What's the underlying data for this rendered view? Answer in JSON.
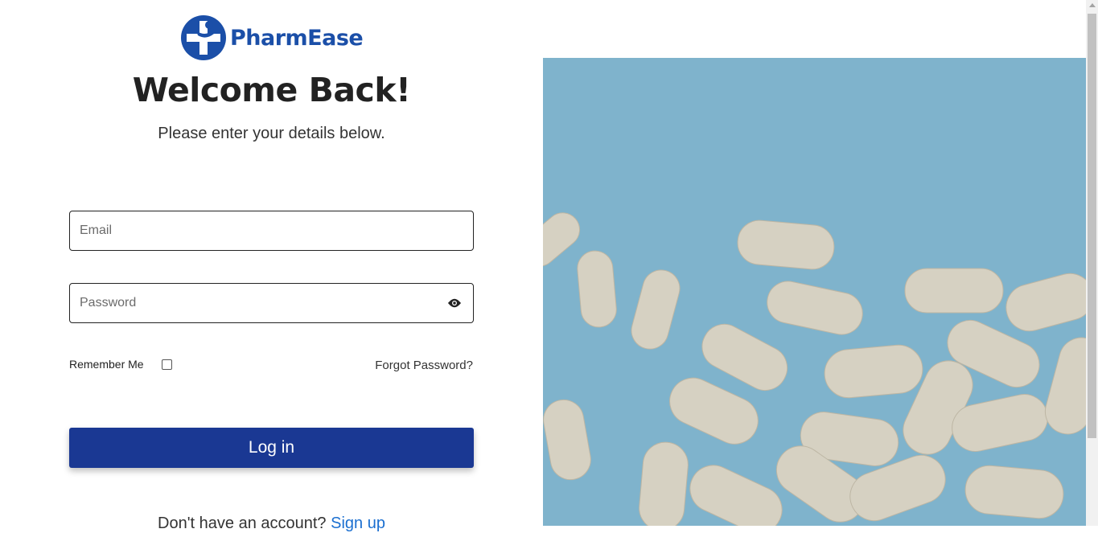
{
  "brand": {
    "name": "PharmEase",
    "color": "#1b4fa8"
  },
  "heading": {
    "title": "Welcome Back!",
    "subtitle": "Please enter your details below."
  },
  "form": {
    "email_placeholder": "Email",
    "password_placeholder": "Password",
    "remember_label": "Remember Me",
    "remember_checked": false,
    "forgot_label": "Forgot Password?",
    "login_label": "Log in",
    "login_color": "#1a3893"
  },
  "signup": {
    "prompt": "Don't have an account?",
    "link_label": "Sign up"
  },
  "hero_image": {
    "description_icon": "pills-photo-icon",
    "background": "#7fb3cc"
  }
}
